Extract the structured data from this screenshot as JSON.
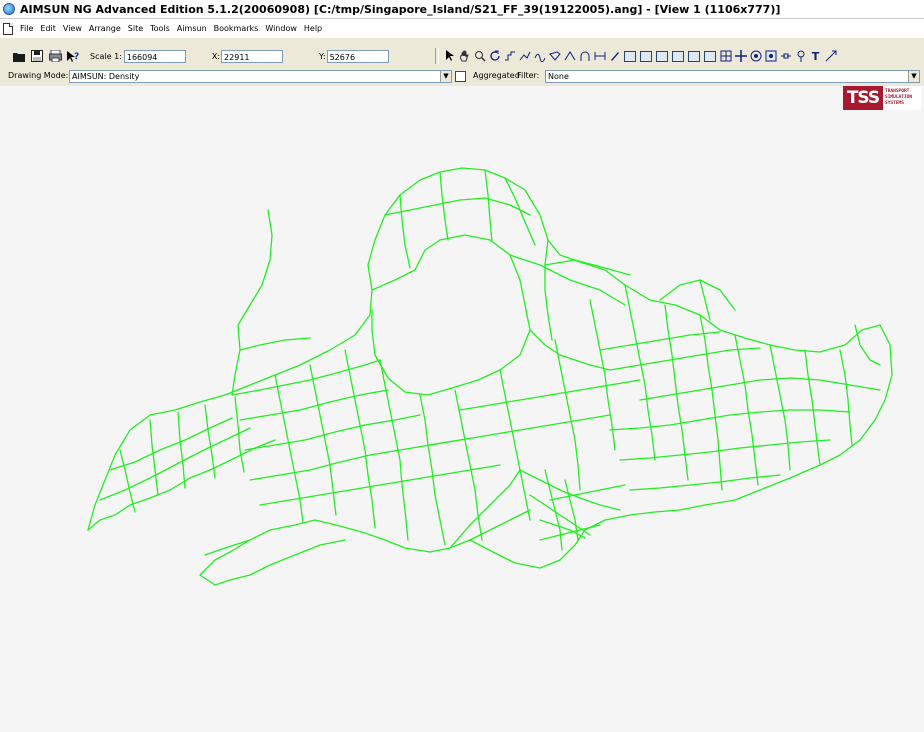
{
  "window": {
    "title": "AIMSUN NG Advanced Edition 5.1.2(20060908)  [C:/tmp/Singapore_Island/S21_FF_39(19122005).ang] - [View 1 (1106x777)]"
  },
  "menu": {
    "items": [
      "File",
      "Edit",
      "View",
      "Arrange",
      "Site",
      "Tools",
      "Aimsun",
      "Bookmarks",
      "Window",
      "Help"
    ]
  },
  "toolbar": {
    "scale_label": "Scale 1:",
    "scale_value": "166094",
    "x_label": "X:",
    "x_value": "22911",
    "y_label": "Y:",
    "y_value": "52676"
  },
  "modebar": {
    "drawing_mode_label": "Drawing Mode:",
    "drawing_mode_value": "AIMSUN: Density",
    "aggregated_label": "Aggregated",
    "aggregated_checked": false,
    "filter_label": "Filter:",
    "filter_value": "None"
  },
  "logo": {
    "mark": "TSS",
    "line1": "TRANSPORT",
    "line2": "SIMULATION",
    "line3": "SYSTEMS"
  },
  "colors": {
    "network": "#22ee22",
    "canvas": "#f5f5f5",
    "logo": "#a6192e"
  }
}
